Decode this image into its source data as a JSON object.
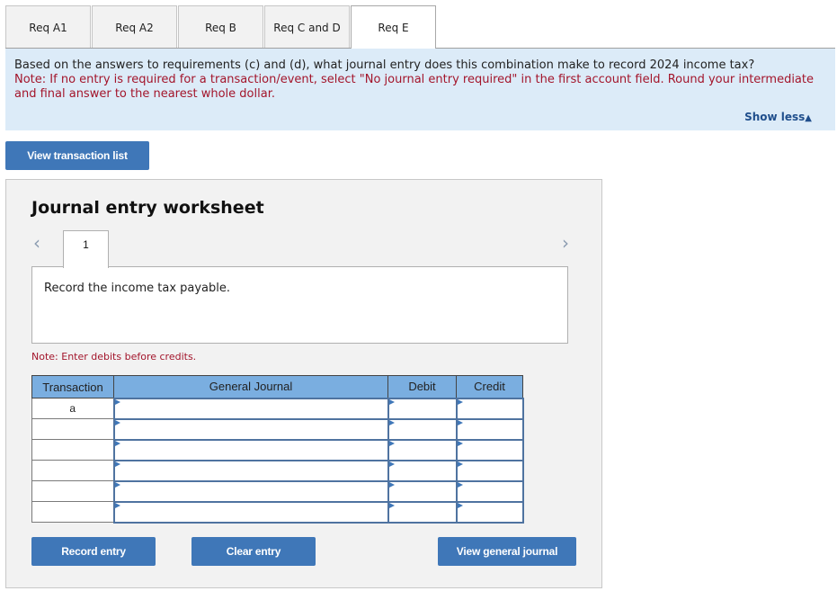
{
  "tabs": [
    {
      "label": "Req A1",
      "active": false
    },
    {
      "label": "Req A2",
      "active": false
    },
    {
      "label": "Req B",
      "active": false
    },
    {
      "label": "Req C and D",
      "active": false
    },
    {
      "label": "Req E",
      "active": true
    }
  ],
  "instructions": {
    "question": "Based on the answers to requirements (c) and (d), what journal entry does this combination make to record 2024 income tax?",
    "note": "Note: If no entry is required for a transaction/event, select \"No journal entry required\" in the first account field. Round your intermediate and final answer to the nearest whole dollar.",
    "show_less_label": "Show less",
    "show_less_icon": "▲"
  },
  "buttons": {
    "view_transaction_list": "View transaction list",
    "record_entry": "Record entry",
    "clear_entry": "Clear entry",
    "view_general_journal": "View general journal"
  },
  "worksheet": {
    "title": "Journal entry worksheet",
    "prev_icon": "‹",
    "next_icon": "›",
    "current_entry": "1",
    "description": "Record the income tax payable.",
    "debit_note": "Note: Enter debits before credits.",
    "table": {
      "headers": [
        "Transaction",
        "General Journal",
        "Debit",
        "Credit"
      ],
      "rows": [
        {
          "transaction": "a",
          "account": "",
          "debit": "",
          "credit": ""
        },
        {
          "transaction": "",
          "account": "",
          "debit": "",
          "credit": ""
        },
        {
          "transaction": "",
          "account": "",
          "debit": "",
          "credit": ""
        },
        {
          "transaction": "",
          "account": "",
          "debit": "",
          "credit": ""
        },
        {
          "transaction": "",
          "account": "",
          "debit": "",
          "credit": ""
        },
        {
          "transaction": "",
          "account": "",
          "debit": "",
          "credit": ""
        }
      ]
    }
  },
  "colors": {
    "button_blue": "#3f77b8",
    "header_blue": "#7aaee0",
    "instruction_bg": "#dcebf8",
    "note_red": "#a3152b",
    "link_blue": "#1f4e8c"
  }
}
